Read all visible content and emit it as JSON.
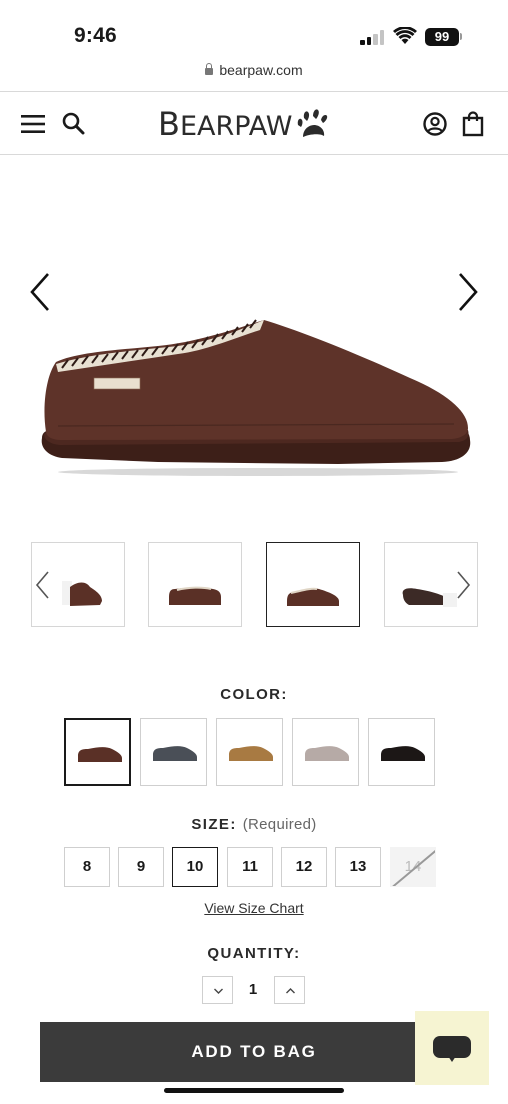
{
  "status_bar": {
    "time": "9:46",
    "battery": "99"
  },
  "browser": {
    "url": "bearpaw.com"
  },
  "header": {
    "logo_text_1": "B",
    "logo_text_2": "EARPAW",
    "icons": [
      "menu-icon",
      "search-icon",
      "account-icon",
      "bag-icon"
    ]
  },
  "gallery": {
    "image_count": 4,
    "selected_thumbnail": 3
  },
  "color": {
    "label": "COLOR:",
    "swatches": [
      {
        "color": "#5a3026",
        "selected": true
      },
      {
        "color": "#4a4f57",
        "selected": false
      },
      {
        "color": "#a87a42",
        "selected": false
      },
      {
        "color": "#b6aaa6",
        "selected": false
      },
      {
        "color": "#1c1716",
        "selected": false
      }
    ]
  },
  "size": {
    "label": "SIZE:",
    "required_text": "(Required)",
    "options": [
      "8",
      "9",
      "10",
      "11",
      "12",
      "13",
      "14"
    ],
    "selected": "10",
    "unavailable": [
      "14"
    ],
    "size_chart_link": "View Size Chart"
  },
  "quantity": {
    "label": "QUANTITY:",
    "value": "1"
  },
  "add_to_bag": {
    "label": "ADD TO BAG"
  },
  "colors": {
    "button": "#3b3b3b",
    "chat_bg": "#f6f4d2",
    "shoe_main": "#5a3026"
  }
}
